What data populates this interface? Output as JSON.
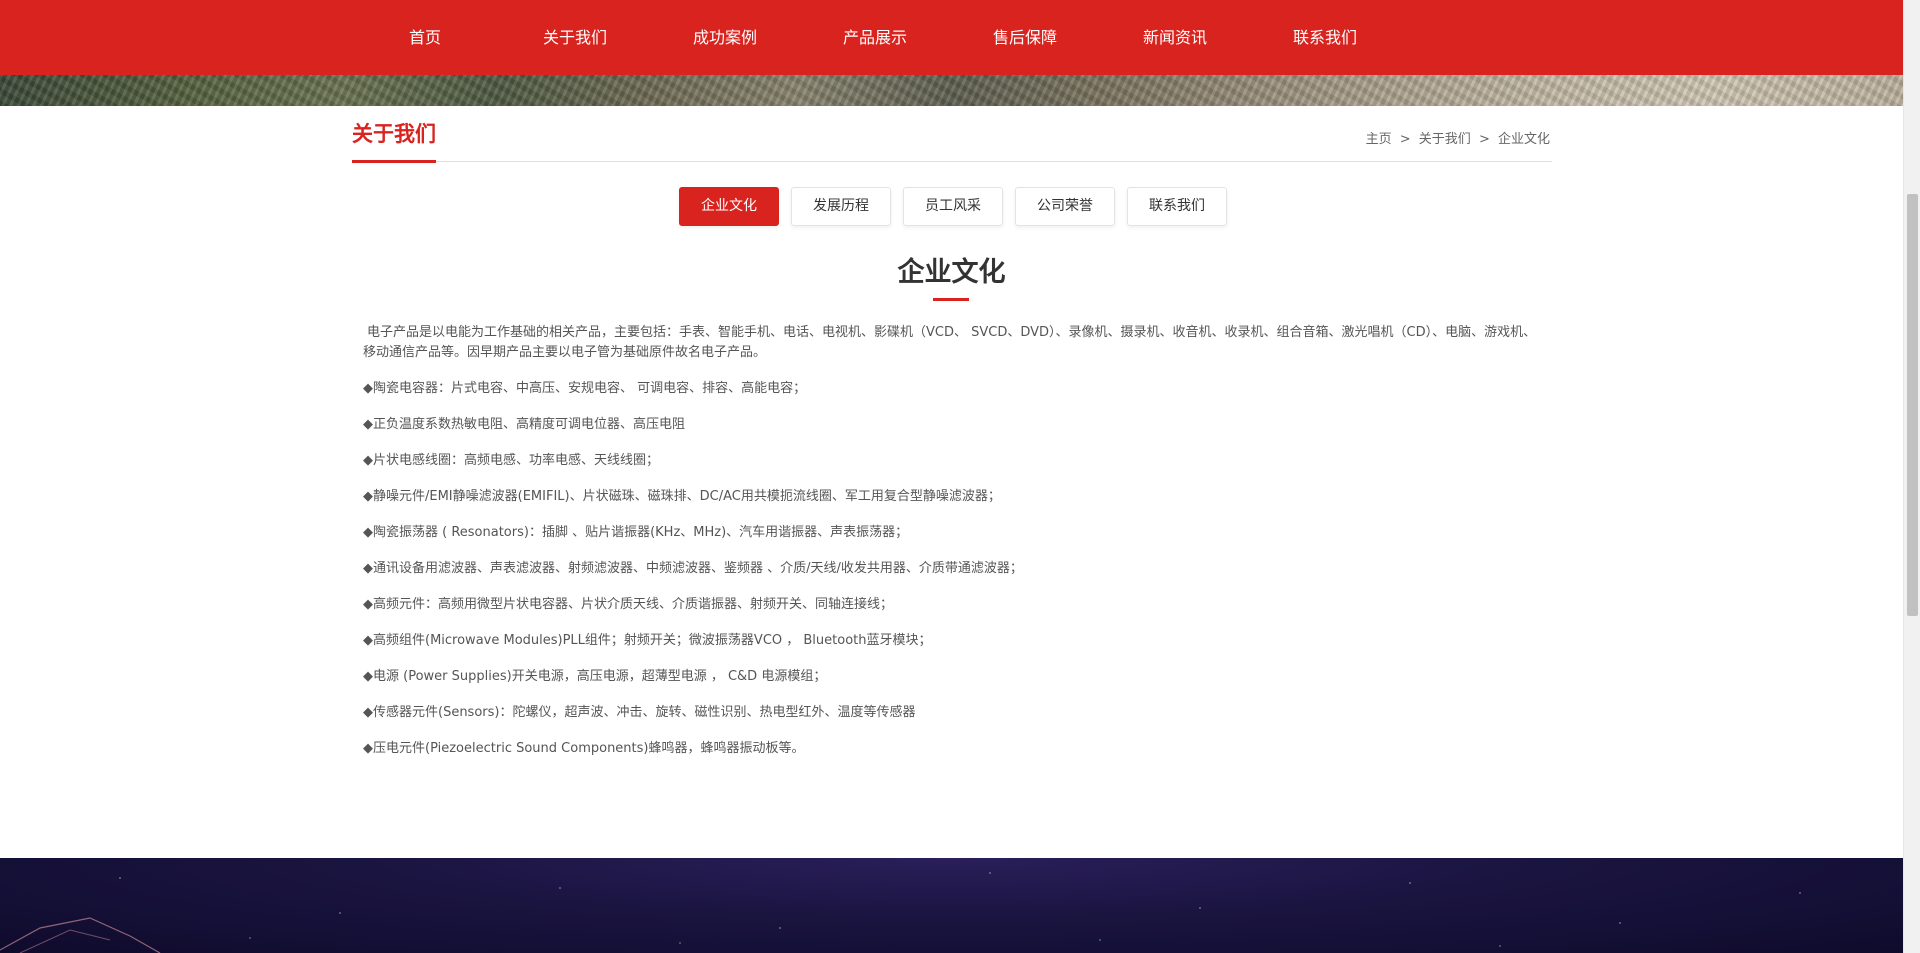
{
  "nav": {
    "items": [
      "首页",
      "关于我们",
      "成功案例",
      "产品展示",
      "售后保障",
      "新闻资讯",
      "联系我们"
    ]
  },
  "section": {
    "title": "关于我们"
  },
  "breadcrumb": {
    "home": "主页",
    "sep1": ">",
    "parent": "关于我们",
    "sep2": ">",
    "current": "企业文化"
  },
  "tabs": {
    "items": [
      "企业文化",
      "发展历程",
      "员工风采",
      "公司荣誉",
      "联系我们"
    ],
    "active_index": 0
  },
  "content": {
    "title": "企业文化",
    "intro": "电子产品是以电能为工作基础的相关产品，主要包括：手表、智能手机、电话、电视机、影碟机（VCD、 SVCD、DVD）、录像机、摄录机、收音机、收录机、组合音箱、激光唱机（CD）、电脑、游戏机、移动通信产品等。因早期产品主要以电子管为基础原件故名电子产品。",
    "items": [
      "◆陶瓷电容器：片式电容、中高压、安规电容、 可调电容、排容、高能电容；",
      "◆正负温度系数热敏电阻、高精度可调电位器、高压电阻",
      "◆片状电感线圈：高频电感、功率电感、天线线圈；",
      "◆静噪元件/EMI静噪滤波器(EMIFIL)、片状磁珠、磁珠排、DC/AC用共模扼流线圈、军工用复合型静噪滤波器；",
      "◆陶瓷振荡器 ( Resonators)：插脚 、贴片谐振器(KHz、MHz)、汽车用谐振器、声表振荡器；",
      "◆通讯设备用滤波器、声表滤波器、射频滤波器、中频滤波器、鉴频器 、介质/天线/收发共用器、介质带通滤波器；",
      "◆高频元件：高频用微型片状电容器、片状介质天线、介质谐振器、射频开关、同轴连接线；",
      "◆高频组件(Microwave Modules)PLL组件；射频开关；微波振荡器VCO ， Bluetooth蓝牙模块；",
      "◆电源 (Power Supplies)开关电源，高压电源，超薄型电源 ， C&D 电源模组；",
      "◆传感器元件(Sensors)：陀螺仪，超声波、冲击、旋转、磁性识别、热电型红外、温度等传感器",
      "◆压电元件(Piezoelectric Sound Components)蜂鸣器，蜂鸣器振动板等。"
    ]
  },
  "colors": {
    "brand_red": "#d9231f",
    "footer_bg": "#1a1440"
  }
}
